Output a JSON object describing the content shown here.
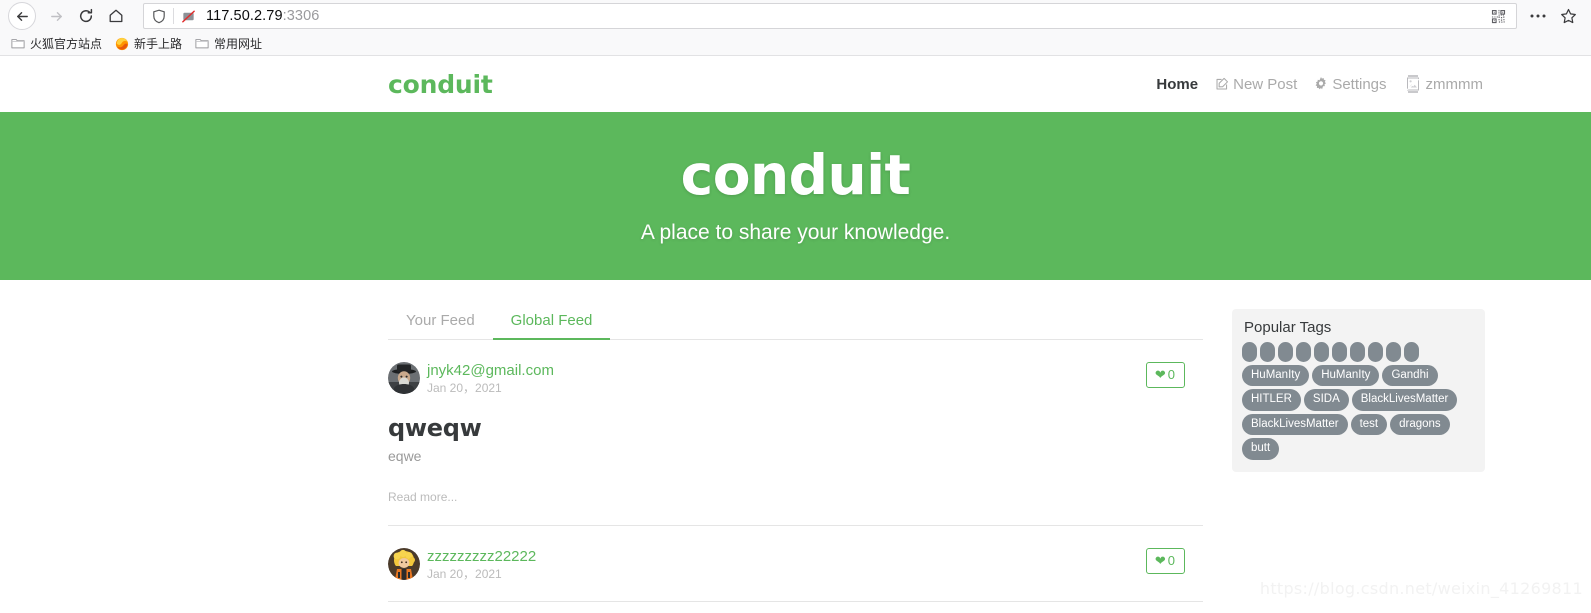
{
  "browser": {
    "back_icon": "back-arrow-icon",
    "forward_icon": "forward-arrow-icon",
    "reload_icon": "reload-icon",
    "home_icon": "home-icon",
    "shield_icon": "shield-icon",
    "blocked_permission_icon": "blocked-permission-icon",
    "url_host": "117.50.2.79",
    "url_port": ":3306",
    "qr_icon": "qr-code-icon",
    "menu_icon": "ellipsis-menu-icon",
    "bookmark_star_icon": "star-icon",
    "bookmarks": [
      {
        "label": "火狐官方站点",
        "icon": "folder-icon"
      },
      {
        "label": "新手上路",
        "icon": "firefox-icon"
      },
      {
        "label": "常用网址",
        "icon": "folder-icon"
      }
    ]
  },
  "site": {
    "brand": "conduit",
    "nav": [
      {
        "label": "Home",
        "icon": null,
        "active": true
      },
      {
        "label": "New Post",
        "icon": "compose-icon",
        "active": false
      },
      {
        "label": "Settings",
        "icon": "gear-icon",
        "active": false
      },
      {
        "label": "zmmmm",
        "icon": "broken-image-icon",
        "active": false
      }
    ]
  },
  "banner": {
    "title": "conduit",
    "subtitle": "A place to share your knowledge.",
    "background_color": "#5cb85c"
  },
  "feed": {
    "tabs": [
      {
        "label": "Your Feed",
        "active": false
      },
      {
        "label": "Global Feed",
        "active": true
      }
    ],
    "articles": [
      {
        "author": "jnyk42@gmail.com",
        "date": "Jan 20，2021",
        "title": "qweqw",
        "description": "eqwe",
        "read_more": "Read more...",
        "favorites_count": "0",
        "avatar": "photo-man-hat"
      },
      {
        "author": "zzzzzzzzz22222",
        "date": "Jan 20，2021",
        "title": "",
        "description": "",
        "read_more": "",
        "favorites_count": "0",
        "avatar": "cartoon-blonde"
      }
    ]
  },
  "sidebar": {
    "title": "Popular Tags",
    "tags": [
      "",
      "",
      "",
      "",
      "",
      "",
      "",
      "",
      "",
      "",
      "HuManIty",
      "HuManIty",
      "Gandhi",
      "HITLER",
      "SIDA",
      "BlackLivesMatter",
      "BlackLivesMatter",
      "test",
      "dragons",
      "butt"
    ],
    "tag_color": "#818a91",
    "panel_color": "#f3f3f3"
  },
  "watermark": "https://blog.csdn.net/weixin_41269811",
  "colors": {
    "brand_green": "#5cb85c",
    "muted_text": "#aaaaaa",
    "heading": "#373a3c"
  }
}
